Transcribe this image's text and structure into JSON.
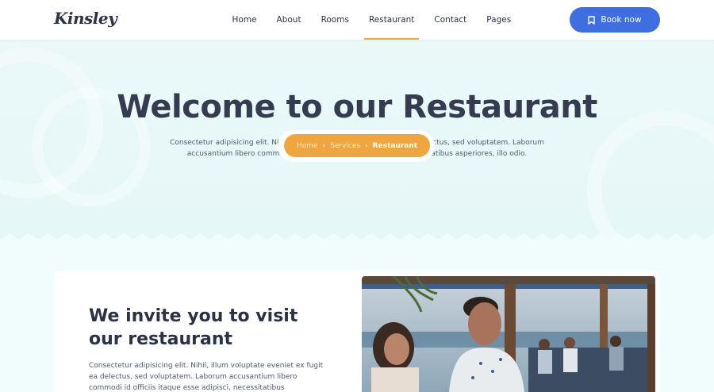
{
  "header": {
    "logo": "Kinsley",
    "nav": [
      {
        "label": "Home"
      },
      {
        "label": "About"
      },
      {
        "label": "Rooms"
      },
      {
        "label": "Restaurant",
        "active": true
      },
      {
        "label": "Contact"
      },
      {
        "label": "Pages"
      }
    ],
    "book_label": "Book now",
    "book_icon": "bookmark-icon"
  },
  "hero": {
    "title": "Welcome to our Restaurant",
    "description": "Consectetur adipisicing elit. Nihil, illum voluptate eveniet ex fugit ea delectus, sed voluptatem. Laborum accusantium libero commodi id officiis itaque esse adipisci, necessitatibus asperiores, illo odio.",
    "breadcrumb": {
      "home": "Home",
      "services": "Services",
      "current": "Restaurant",
      "separator_icon": "chevron-right-icon"
    }
  },
  "section": {
    "title": "We invite you to visit our restaurant",
    "text": "Consectetur adipisicing elit. Nihil, illum voluptate eveniet ex fugit ea delectus, sed voluptatem. Laborum accusantium libero commodi id officiis itaque esse adipisci, necessitatibus"
  },
  "colors": {
    "accent_orange": "#efa641",
    "primary_blue": "#3e6ee0",
    "hero_bg": "#eaf8f8",
    "text_dark": "#2b3245"
  }
}
